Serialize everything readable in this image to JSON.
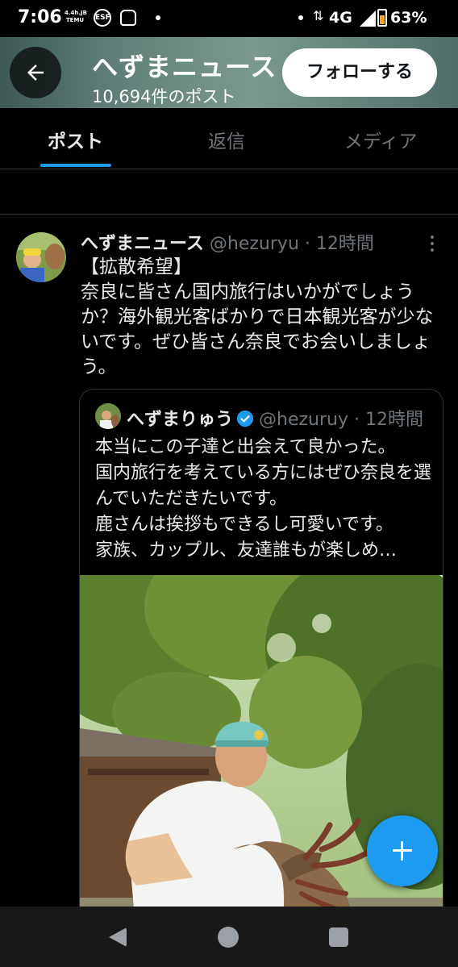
{
  "status_bar": {
    "time": "7:06",
    "temu_label": "TEMU",
    "temu_sub": "4.4h.JB",
    "circle_label": "ESF",
    "network": "4G",
    "battery": "63%",
    "battery_level": 0.63,
    "arrows": "⇅"
  },
  "header": {
    "name": "へずまニュース",
    "post_count": "10,694件のポスト",
    "follow_label": "フォローする",
    "back_icon": "arrow-left-icon"
  },
  "tabs": [
    {
      "label": "ポスト",
      "active": true
    },
    {
      "label": "返信",
      "active": false
    },
    {
      "label": "メディア",
      "active": false
    }
  ],
  "tweet": {
    "name": "へずまニュース",
    "handle": "@hezuryu",
    "time": "· 12時間",
    "text": "【拡散希望】\n奈良に皆さん国内旅行はいかがでしょうか？海外観光客ばかりで日本観光客が少ないです。ぜひ皆さん奈良でお会いしましょう。",
    "quote": {
      "name": "へずまりゅう",
      "verified": true,
      "handle": "@hezuruy",
      "time": "· 12時間",
      "text": "本当にこの子達と出会えて良かった。\n国内旅行を考えている方にはぜひ奈良を選んでいただきたいです。\n鹿さんは挨拶もできるし可愛いです。\n家族、カップル、友達誰もが楽しめ…",
      "photo": "man-feeding-deer-photo"
    }
  },
  "colors": {
    "accent": "#1d9bf0",
    "background": "#000000",
    "text_primary": "#e7e9ea",
    "text_secondary": "#71767b",
    "border": "#2f3336"
  },
  "icons": {
    "fab": "plus-icon",
    "more": "more-vertical-icon",
    "nav_back": "nav-back-icon",
    "nav_home": "nav-home-icon",
    "nav_recent": "nav-recents-icon"
  }
}
